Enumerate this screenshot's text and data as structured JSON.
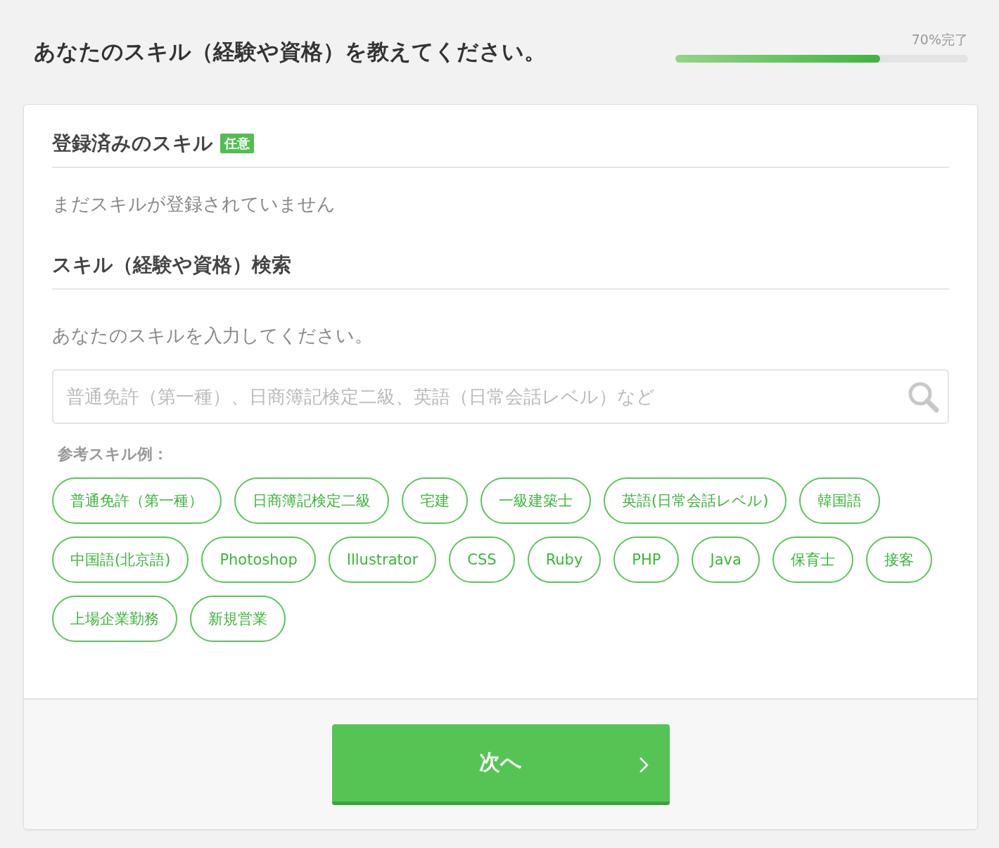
{
  "header": {
    "title": "あなたのスキル（経験や資格）を教えてください。",
    "progress": {
      "label": "70%完了",
      "level": 0.7
    }
  },
  "registered": {
    "heading": "登録済みのスキル",
    "badge": "任意",
    "empty_text": "まだスキルが登録されていません"
  },
  "search": {
    "heading": "スキル（経験や資格）検索",
    "prompt": "あなたのスキルを入力してください。",
    "placeholder": "普通免許（第一種）、日商簿記検定二級、英語（日常会話レベル）など"
  },
  "examples": {
    "label": "参考スキル例：",
    "chips": [
      "普通免許（第一種）",
      "日商簿記検定二級",
      "宅建",
      "一級建築士",
      "英語(日常会話レベル)",
      "韓国語",
      "中国語(北京語)",
      "Photoshop",
      "Illustrator",
      "CSS",
      "Ruby",
      "PHP",
      "Java",
      "保育士",
      "接客",
      "上場企業勤務",
      "新規営業"
    ]
  },
  "footer": {
    "next_button": "次へ"
  }
}
